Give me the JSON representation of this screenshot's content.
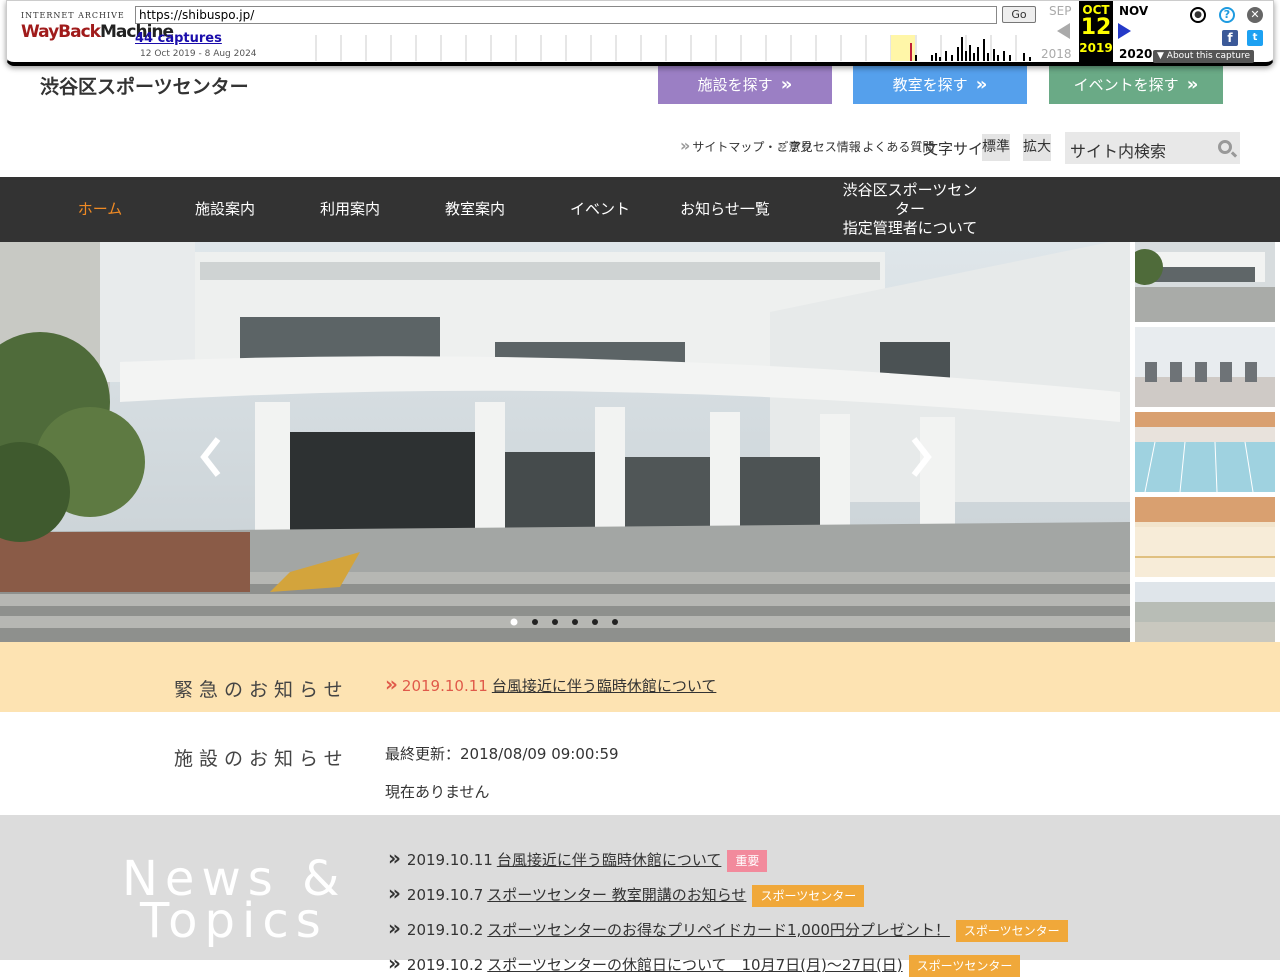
{
  "wayback": {
    "logo_top": "INTERNET ARCHIVE",
    "logo_wayback": "WayBack",
    "logo_machine": "Machine",
    "url": "https://shibuspo.jp/",
    "go_label": "Go",
    "captures": "44 captures",
    "range": "12 Oct 2019 - 8 Aug 2024",
    "prev_month": "SEP",
    "cur_month": "OCT",
    "cur_day": "12",
    "cur_year": "2019",
    "next_month": "NOV",
    "prev_year": "2018",
    "next_year": "2020",
    "about": "▼ About this capture"
  },
  "header": {
    "site_title": "渋谷区スポーツセンター",
    "buttons": [
      {
        "label": "施設を探す",
        "color": "#9b7fc4"
      },
      {
        "label": "教室を探す",
        "color": "#55a0ec"
      },
      {
        "label": "イベントを探す",
        "color": "#6aaa86"
      }
    ],
    "util_links": [
      "サイトマップ・ご意見",
      "アクセス情報",
      "よくある質問"
    ],
    "font_size_label": "文字サイズ",
    "font_size_buttons": [
      "標準",
      "拡大"
    ],
    "search_placeholder": "サイト内検索"
  },
  "nav": {
    "items": [
      {
        "label": "ホーム",
        "active": true
      },
      {
        "label": "施設案内",
        "active": false
      },
      {
        "label": "利用案内",
        "active": false
      },
      {
        "label": "教室案内",
        "active": false
      },
      {
        "label": "イベント",
        "active": false
      },
      {
        "label": "お知らせ一覧",
        "active": false
      },
      {
        "label": "渋谷区スポーツセンター",
        "label2": "指定管理者について",
        "active": false
      }
    ]
  },
  "slider": {
    "dots": 6,
    "active_dot": 0
  },
  "emergency": {
    "label": "緊急のお知らせ",
    "date": "2019.10.11",
    "text": "台風接近に伴う臨時休館について"
  },
  "info": {
    "label": "施設のお知らせ",
    "updated": "最終更新：2018/08/09 09:00:59",
    "body": "現在ありません"
  },
  "news": {
    "title_line1": "News &",
    "title_line2": "Topics",
    "items": [
      {
        "date": "2019.10.11",
        "text": "台風接近に伴う臨時休館について",
        "tag": "重要",
        "tag_color": "#f28a9c"
      },
      {
        "date": "2019.10.7",
        "text": "スポーツセンター 教室開講のお知らせ",
        "tag": "スポーツセンター",
        "tag_color": "#f0a83a"
      },
      {
        "date": "2019.10.2",
        "text": "スポーツセンターのお得なプリペイドカード1,000円分プレゼント！",
        "tag": "スポーツセンター",
        "tag_color": "#f0a83a"
      },
      {
        "date": "2019.10.2",
        "text": "スポーツセンターの休館日について　10月7日(月)〜27日(日)",
        "tag": "スポーツセンター",
        "tag_color": "#f0a83a"
      }
    ]
  }
}
